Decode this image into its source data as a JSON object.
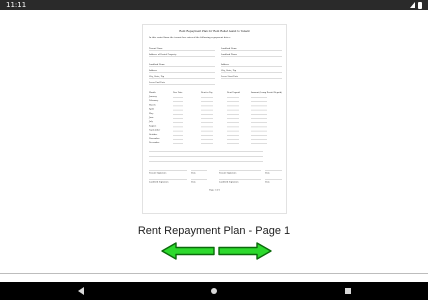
{
  "status_bar": {
    "time": "11:11"
  },
  "document": {
    "title": "Rent Repayment Plan for Rent Relief Assist to Tenant",
    "intro": "In this rental form the tenant has entered the following repayment dates:",
    "fields": [
      "Tenant Name",
      "Landlord Name",
      "Address of Rental Property",
      "Landlord Phone",
      "Landlord Name",
      "Address",
      "Address",
      "City, State, Zip",
      "City, State, Zip",
      "Lease Start Date",
      "Lease End Date"
    ],
    "months": [
      "January",
      "February",
      "March",
      "April",
      "May",
      "June",
      "July",
      "August",
      "September",
      "October",
      "November",
      "December"
    ],
    "columns": [
      "Month",
      "Due Date",
      "Rent to Pay",
      "Rent Unpaid",
      "Amount (Lump Rental Repaid)"
    ],
    "signatures": [
      "Tenant Signature",
      "Date",
      "Tenant Signature",
      "Date",
      "Landlord Signature",
      "Date",
      "Landlord Signature",
      "Date"
    ],
    "footer": "Page 1 of 1"
  },
  "page_label": "Rent Repayment Plan - Page 1",
  "colors": {
    "arrow_fill": "#2dd92d",
    "arrow_stroke": "#0b6a0b"
  },
  "icons": {
    "prev": "left-arrow-icon",
    "next": "right-arrow-icon"
  }
}
